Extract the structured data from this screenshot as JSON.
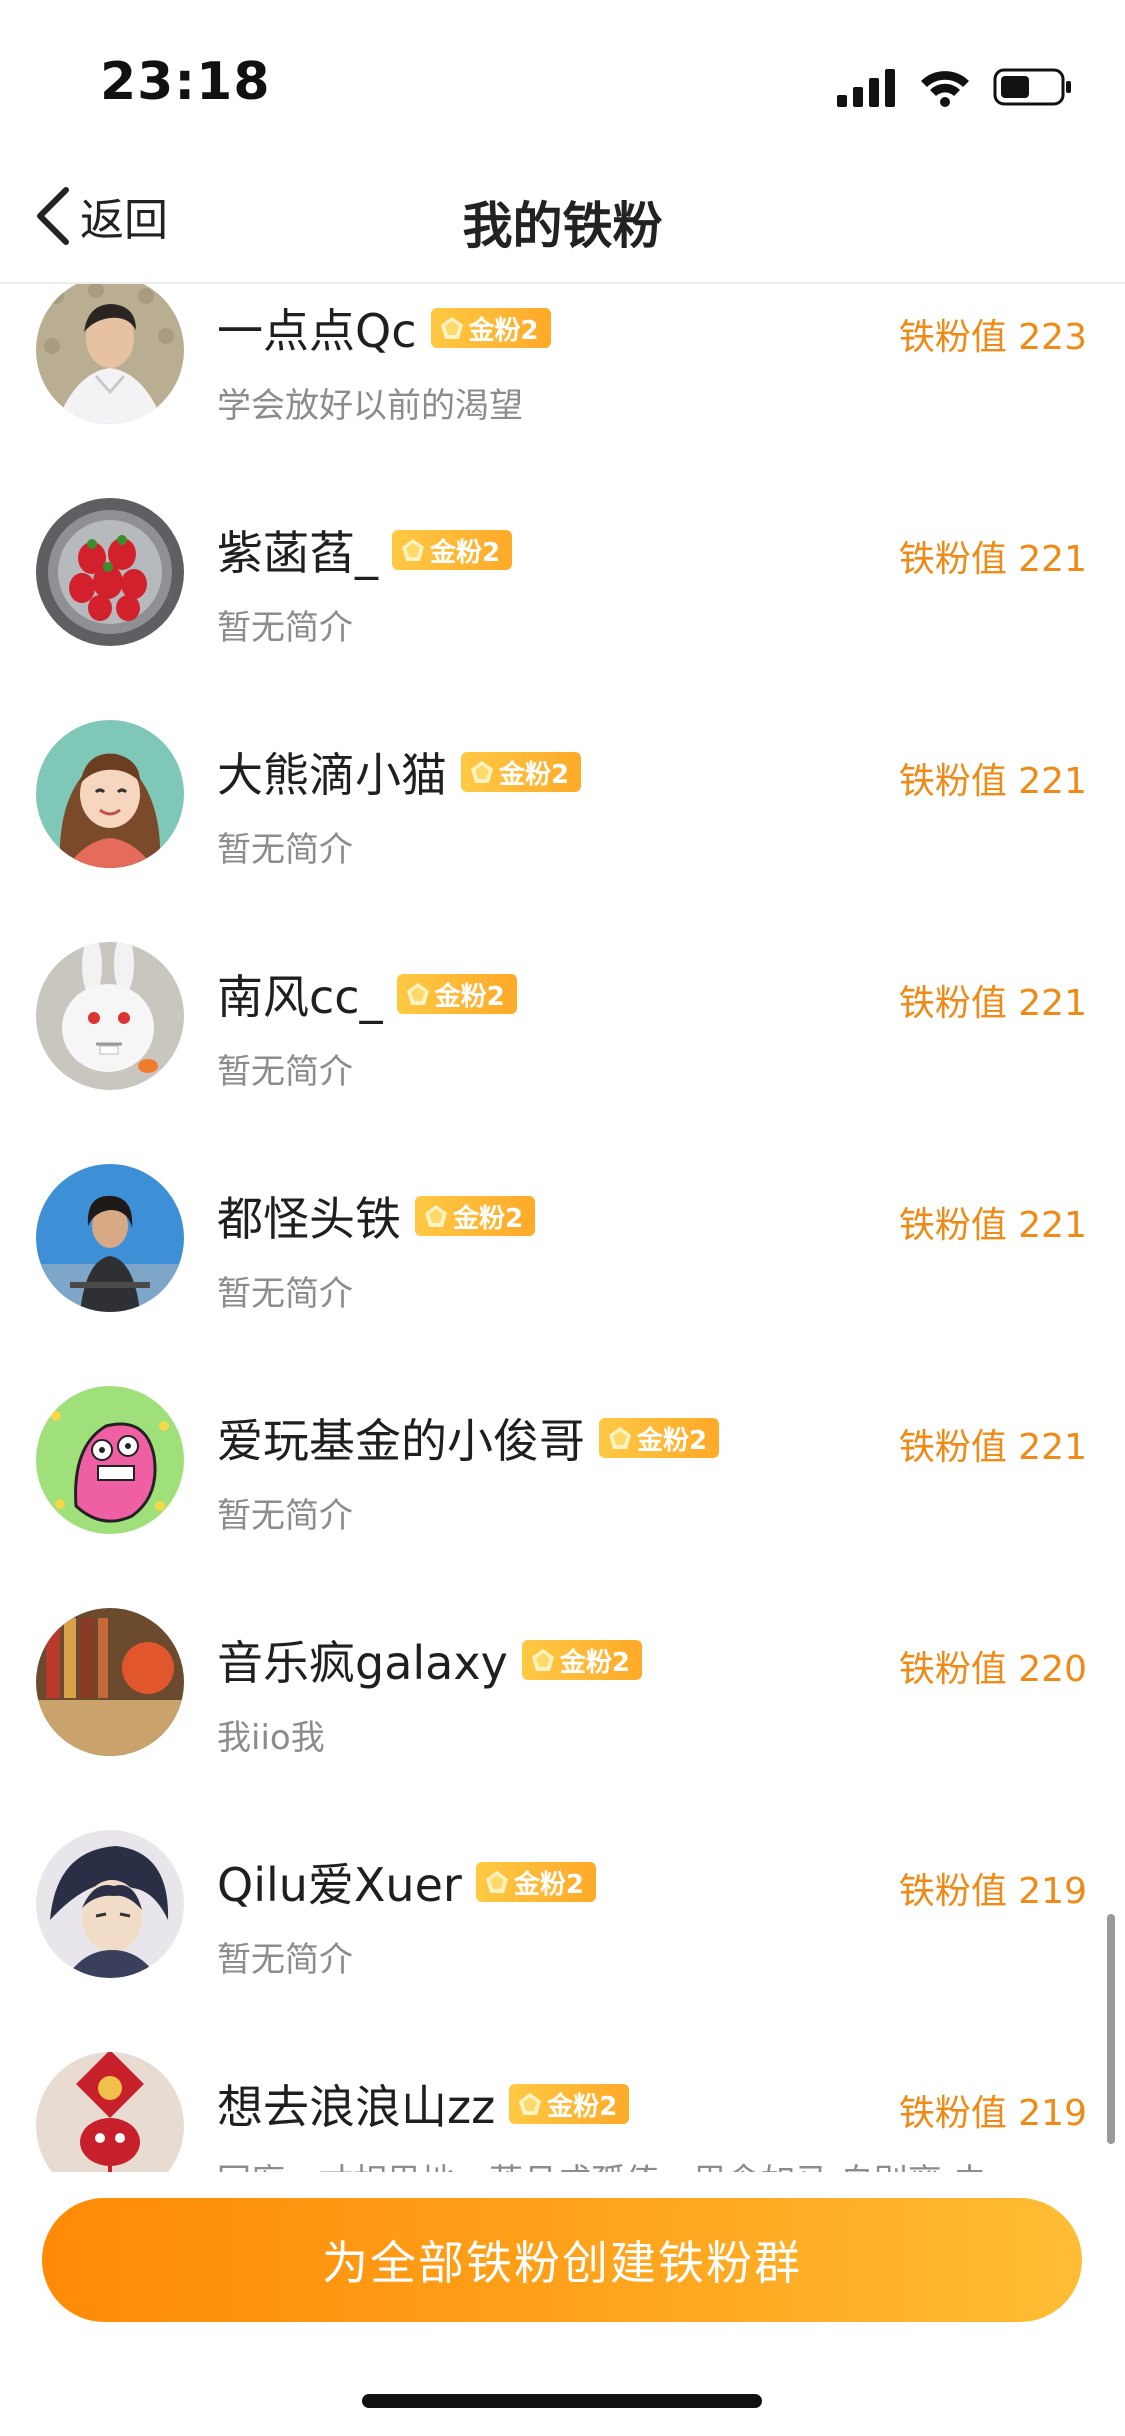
{
  "status_bar": {
    "time": "23:18"
  },
  "nav": {
    "back_label": "返回",
    "title": "我的铁粉"
  },
  "fans": [
    {
      "name": "一点点Qc",
      "badge": "金粉2",
      "score": "铁粉值 223",
      "desc": "学会放好以前的渴望"
    },
    {
      "name": "紫菡萏_",
      "badge": "金粉2",
      "score": "铁粉值 221",
      "desc": "暂无简介"
    },
    {
      "name": "大熊滴小猫",
      "badge": "金粉2",
      "score": "铁粉值 221",
      "desc": "暂无简介"
    },
    {
      "name": "南风cc_",
      "badge": "金粉2",
      "score": "铁粉值 221",
      "desc": "暂无简介"
    },
    {
      "name": "都怪头铁",
      "badge": "金粉2",
      "score": "铁粉值 221",
      "desc": "暂无简介"
    },
    {
      "name": "爱玩基金的小俊哥",
      "badge": "金粉2",
      "score": "铁粉值 221",
      "desc": "暂无简介"
    },
    {
      "name": "音乐疯galaxy",
      "badge": "金粉2",
      "score": "铁粉值 220",
      "desc": "我iio我"
    },
    {
      "name": "Qilu爱Xuer",
      "badge": "金粉2",
      "score": "铁粉值 219",
      "desc": "暂无简介"
    },
    {
      "name": "想去浪浪山zz",
      "badge": "金粉2",
      "score": "铁粉值 219",
      "desc": "回廊一寸相思地，落月成孤倚。思念如马 自别离 未…"
    }
  ],
  "bottom": {
    "create_button": "为全部铁粉创建铁粉群"
  },
  "colors": {
    "accent": "#f08a16",
    "badge": "#ffb52e",
    "button_start": "#ff8a06",
    "button_end": "#ffbd35"
  }
}
